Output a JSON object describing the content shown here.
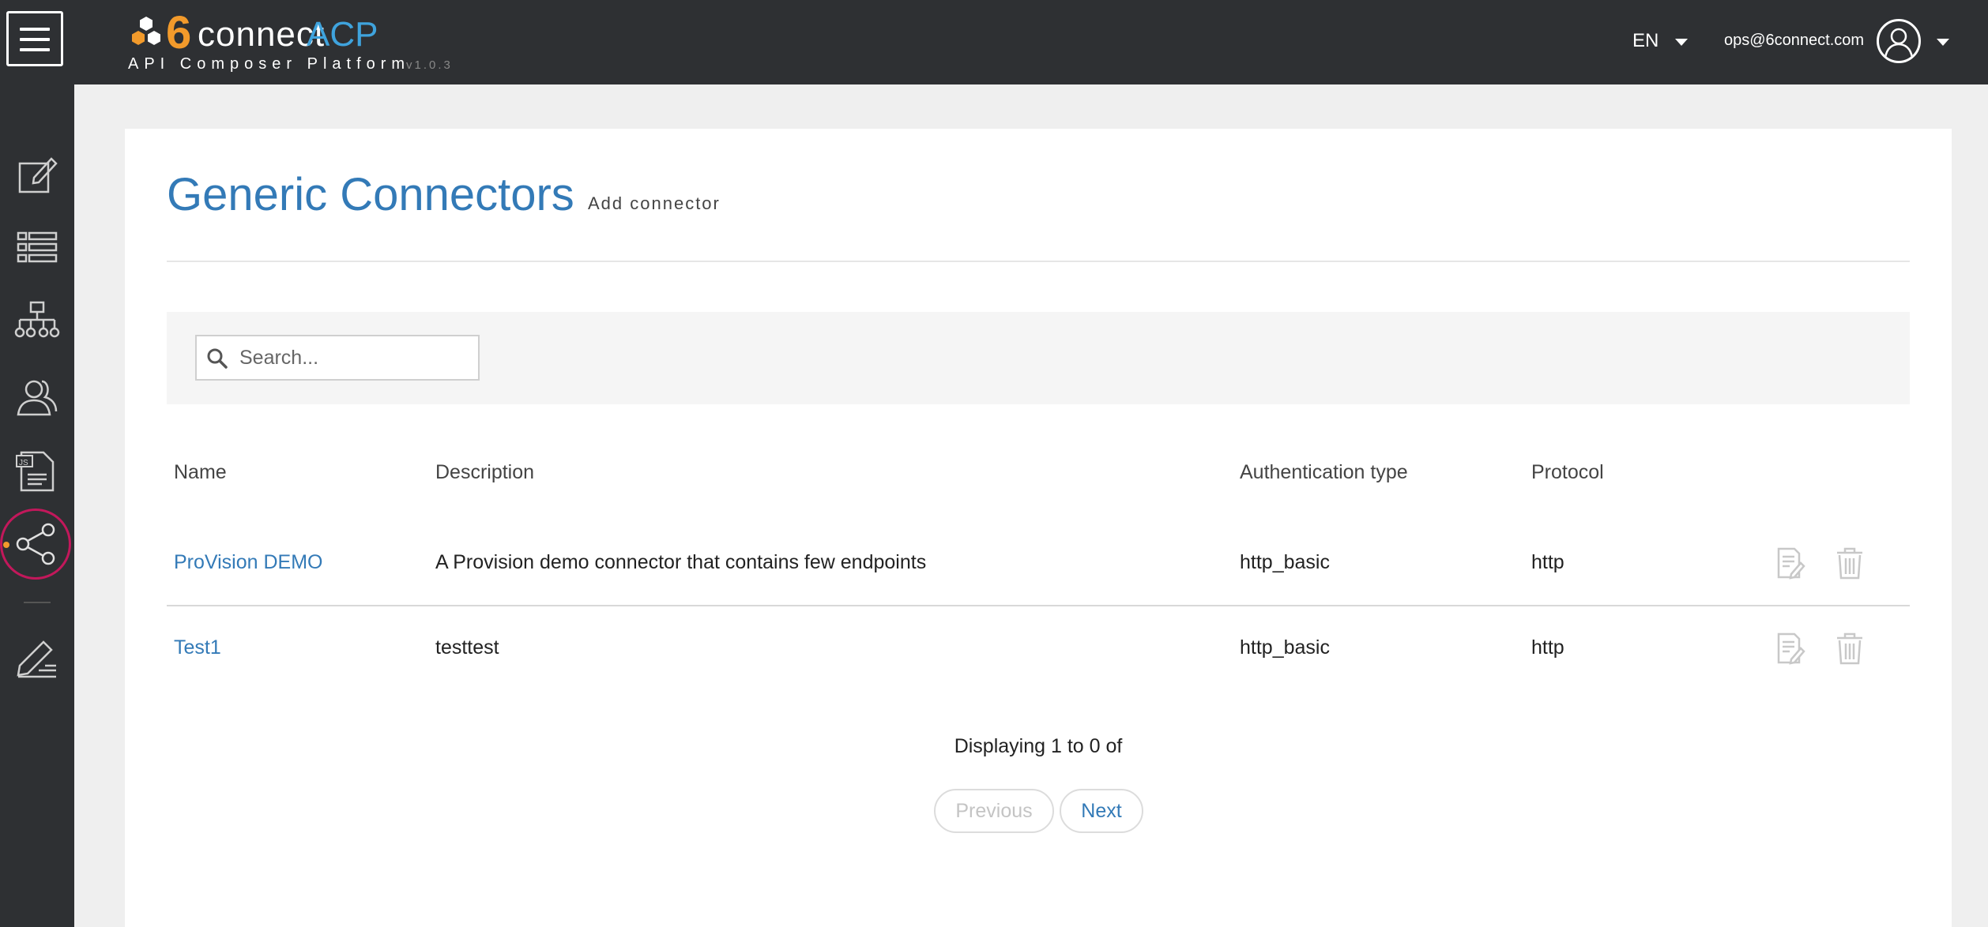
{
  "header": {
    "menu_icon": "hamburger-menu-icon",
    "logo": {
      "six": "6",
      "connect": "connect",
      "acp": "ACP",
      "subtitle": "API Composer Platform",
      "version": "v1.0.3"
    },
    "language": "EN",
    "user_email": "ops@6connect.com",
    "avatar_icon": "user-avatar-icon"
  },
  "sidebar": {
    "items": [
      {
        "icon": "edit-icon"
      },
      {
        "icon": "list-icon"
      },
      {
        "icon": "hierarchy-icon"
      },
      {
        "icon": "users-icon"
      },
      {
        "icon": "script-file-icon"
      },
      {
        "icon": "share-icon",
        "active": true
      },
      {
        "icon": "signature-icon"
      }
    ],
    "active_color": "#c2185b"
  },
  "page": {
    "title": "Generic Connectors",
    "add_label": "Add connector",
    "search_placeholder": "Search..."
  },
  "table": {
    "columns": [
      "Name",
      "Description",
      "Authentication type",
      "Protocol"
    ],
    "rows": [
      {
        "name": "ProVision DEMO",
        "description": "A Provision demo connector that contains few endpoints",
        "auth": "http_basic",
        "protocol": "http"
      },
      {
        "name": "Test1",
        "description": "testtest",
        "auth": "http_basic",
        "protocol": "http"
      }
    ]
  },
  "pagination": {
    "summary": "Displaying 1 to 0 of",
    "previous": "Previous",
    "next": "Next"
  },
  "colors": {
    "topbar": "#2e3033",
    "link": "#337ab7",
    "accent_orange": "#f29a2b",
    "accent_blue": "#3fa3dd"
  }
}
